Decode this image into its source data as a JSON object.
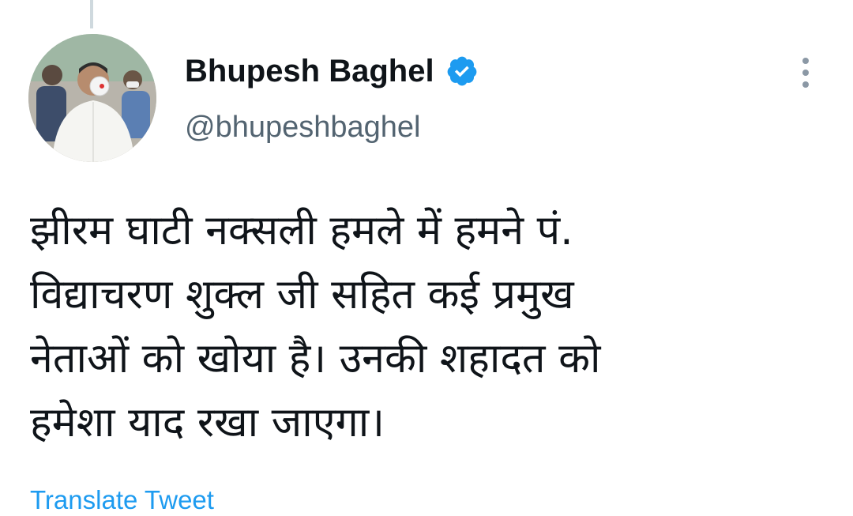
{
  "author": {
    "display_name": "Bhupesh Baghel",
    "handle": "@bhupeshbaghel",
    "verified": true
  },
  "tweet": {
    "text_lines": [
      "झीरम घाटी नक्सली हमले में हमने पं.",
      "विद्याचरण शुक्ल जी सहित कई प्रमुख",
      "नेताओं को खोया है। उनकी शहादत को",
      "हमेशा याद रखा जाएगा।"
    ]
  },
  "actions": {
    "translate_label": "Translate Tweet"
  },
  "icons": {
    "verified": "verified-badge-icon",
    "more": "more-options-icon"
  },
  "colors": {
    "verified_blue": "#1d9bf0",
    "link_blue": "#1d9bf0",
    "handle_gray": "#536471",
    "text": "#0f1419"
  }
}
